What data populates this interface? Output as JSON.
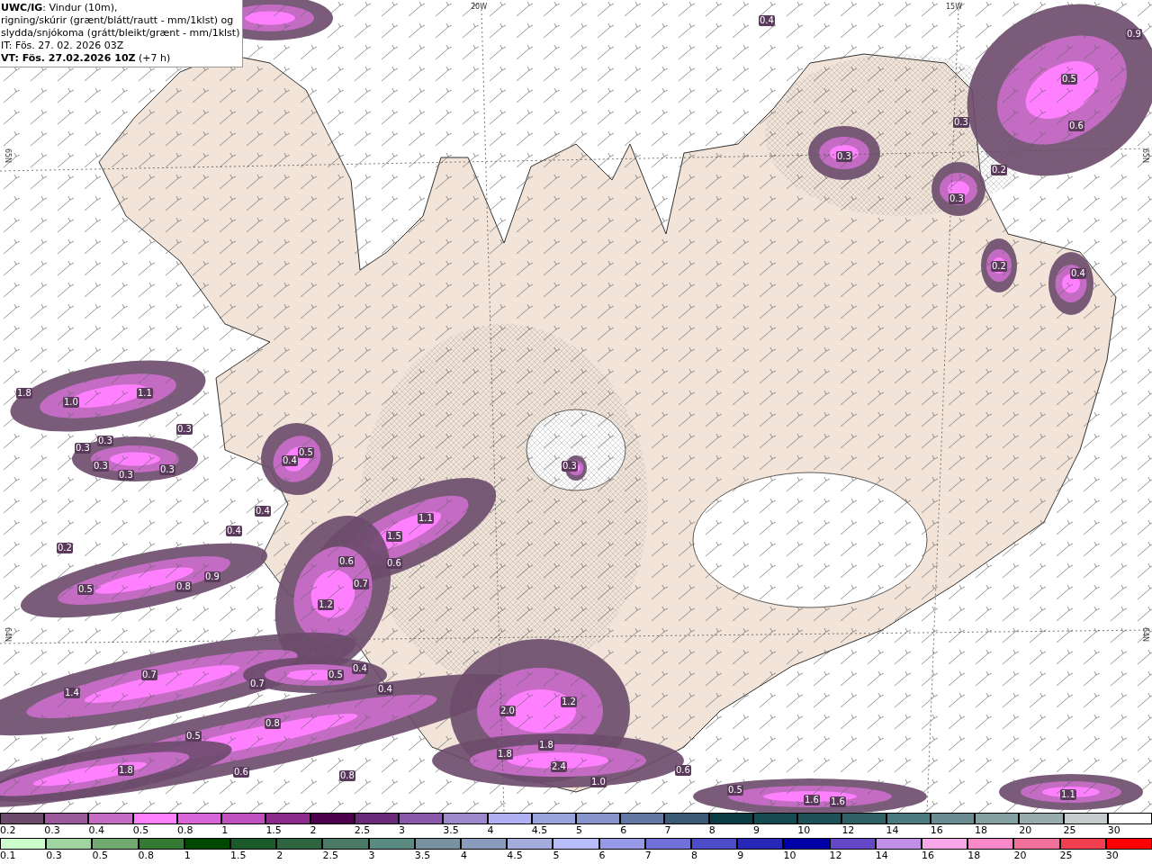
{
  "title_lines": [
    "**UWC/IG**: Vindur (10m),",
    "rigning/skúrir (grænt/blátt/rautt - mm/1klst) og",
    "slydda/snjókoma (grátt/bleikt/grænt - mm/1klst)",
    "IT: Fös. 27. 02. 2026 03Z",
    "**VT: Fös. 27.02.2026 10Z** (+7 h)"
  ],
  "map": {
    "grid_labels": [
      "20W",
      "15W",
      "65N",
      "65N",
      "64N",
      "64N"
    ],
    "values": [
      "0.4",
      "0.9",
      "0.5",
      "0.6",
      "0.3",
      "0.3",
      "0.2",
      "0.3",
      "0.2",
      "0.4",
      "1.8",
      "1.0",
      "1.1",
      "0.3",
      "0.3",
      "0.3",
      "0.3",
      "0.3",
      "0.3",
      "0.5",
      "0.4",
      "0.3",
      "1.1",
      "0.4",
      "0.4",
      "1.5",
      "0.2",
      "0.6",
      "0.6",
      "0.9",
      "0.5",
      "0.8",
      "0.7",
      "1.2",
      "0.7",
      "0.5",
      "0.4",
      "1.4",
      "0.7",
      "0.4",
      "1.2",
      "2.0",
      "0.8",
      "0.5",
      "1.8",
      "1.8",
      "2.4",
      "1.8",
      "0.6",
      "0.8",
      "0.6",
      "1.0",
      "0.5",
      "1.6",
      "1.6",
      "1.1"
    ]
  },
  "legend_snow": [
    {
      "label": "0.2",
      "color": "#6b4a6b"
    },
    {
      "label": "0.3",
      "color": "#9a5a9a"
    },
    {
      "label": "0.4",
      "color": "#c46cc4"
    },
    {
      "label": "0.5",
      "color": "#ff80ff"
    },
    {
      "label": "0.8",
      "color": "#d866d8"
    },
    {
      "label": "1",
      "color": "#c050c0"
    },
    {
      "label": "1.5",
      "color": "#8c2a8c"
    },
    {
      "label": "2",
      "color": "#4c004c"
    },
    {
      "label": "2.5",
      "color": "#6a2a7a"
    },
    {
      "label": "3",
      "color": "#8a58aa"
    },
    {
      "label": "3.5",
      "color": "#9e88cc"
    },
    {
      "label": "4",
      "color": "#b0b0f4"
    },
    {
      "label": "4.5",
      "color": "#98a4dc"
    },
    {
      "label": "5",
      "color": "#8894cc"
    },
    {
      "label": "6",
      "color": "#6478a4"
    },
    {
      "label": "7",
      "color": "#3a5a78"
    },
    {
      "label": "8",
      "color": "#0c3c44"
    },
    {
      "label": "9",
      "color": "#164a52"
    },
    {
      "label": "10",
      "color": "#1e5058"
    },
    {
      "label": "12",
      "color": "#2e6066"
    },
    {
      "label": "14",
      "color": "#4a7a7e"
    },
    {
      "label": "16",
      "color": "#6a8c90"
    },
    {
      "label": "18",
      "color": "#84a0a2"
    },
    {
      "label": "20",
      "color": "#98acae"
    },
    {
      "label": "25",
      "color": "#c4cccc"
    },
    {
      "label": "30",
      "color": "#ffffff"
    }
  ],
  "legend_rain": [
    {
      "label": "0.1",
      "color": "#ccffcc"
    },
    {
      "label": "0.3",
      "color": "#a0d4a0"
    },
    {
      "label": "0.5",
      "color": "#70aa70"
    },
    {
      "label": "0.8",
      "color": "#347a34"
    },
    {
      "label": "1",
      "color": "#004800"
    },
    {
      "label": "1.5",
      "color": "#1c5a2c"
    },
    {
      "label": "2",
      "color": "#2e6440"
    },
    {
      "label": "2.5",
      "color": "#4a7a66"
    },
    {
      "label": "3",
      "color": "#5a8a80"
    },
    {
      "label": "3.5",
      "color": "#7890a0"
    },
    {
      "label": "4",
      "color": "#8a9cbc"
    },
    {
      "label": "4.5",
      "color": "#a4acde"
    },
    {
      "label": "5",
      "color": "#b8bcf8"
    },
    {
      "label": "6",
      "color": "#9898e8"
    },
    {
      "label": "7",
      "color": "#7070d8"
    },
    {
      "label": "8",
      "color": "#4c4cc8"
    },
    {
      "label": "9",
      "color": "#2828b8"
    },
    {
      "label": "10",
      "color": "#0000a8"
    },
    {
      "label": "12",
      "color": "#6448c8"
    },
    {
      "label": "14",
      "color": "#c090e8"
    },
    {
      "label": "16",
      "color": "#f8a8e8"
    },
    {
      "label": "18",
      "color": "#f888c8"
    },
    {
      "label": "20",
      "color": "#f0709c"
    },
    {
      "label": "25",
      "color": "#f04050"
    },
    {
      "label": "30",
      "color": "#ff0000"
    }
  ]
}
